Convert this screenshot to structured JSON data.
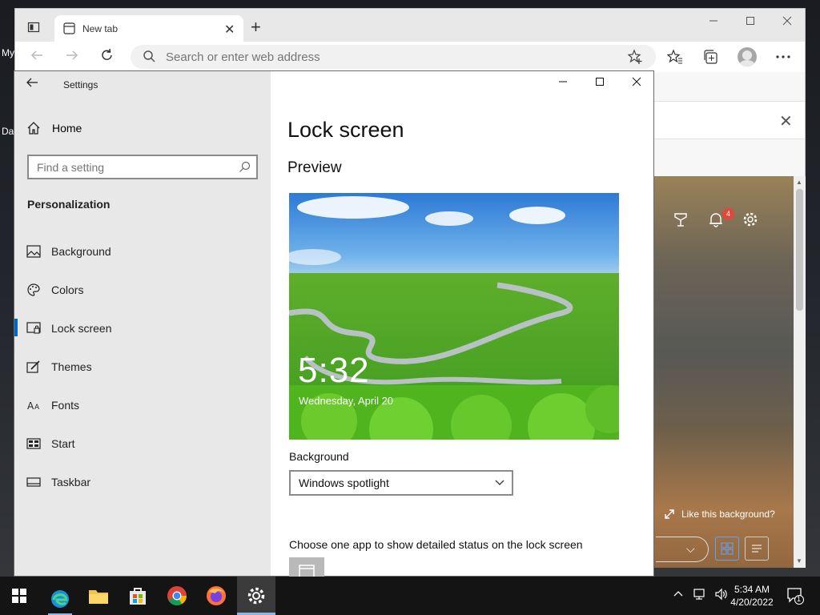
{
  "desktop": {
    "labels": [
      "My",
      "Da"
    ]
  },
  "browser": {
    "tab_title": "New tab",
    "new_tab": "+",
    "close_tab": "✕",
    "address_placeholder": "Search or enter web address",
    "infobar_close": "✕",
    "notification_count": "4",
    "like_background": "Like this background?"
  },
  "settings": {
    "window_title": "Settings",
    "home_label": "Home",
    "search_placeholder": "Find a setting",
    "section_title": "Personalization",
    "nav_items": [
      {
        "label": "Background",
        "icon": "picture-icon"
      },
      {
        "label": "Colors",
        "icon": "palette-icon"
      },
      {
        "label": "Lock screen",
        "icon": "lock-screen-icon",
        "selected": true
      },
      {
        "label": "Themes",
        "icon": "brush-icon"
      },
      {
        "label": "Fonts",
        "icon": "font-icon"
      },
      {
        "label": "Start",
        "icon": "start-icon"
      },
      {
        "label": "Taskbar",
        "icon": "taskbar-icon"
      }
    ],
    "page_title": "Lock screen",
    "preview_title": "Preview",
    "preview_time": "5:32",
    "preview_date": "Wednesday, April 20",
    "background_label": "Background",
    "background_value": "Windows spotlight",
    "app_status_label": "Choose one app to show detailed status on the lock screen",
    "accent_color": "#0067c0"
  },
  "taskbar": {
    "time": "5:34 AM",
    "date": "4/20/2022",
    "notification_count": "1"
  }
}
